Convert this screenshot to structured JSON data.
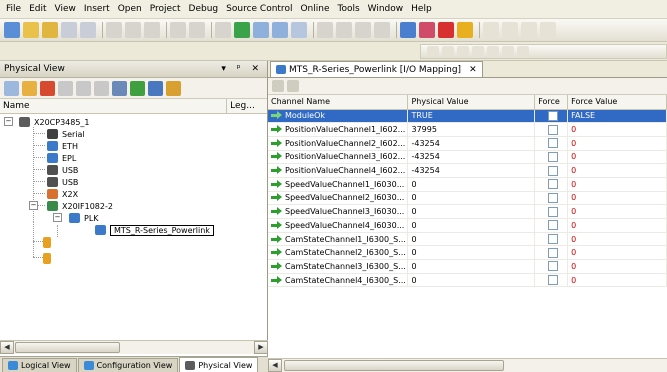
{
  "menu": [
    "File",
    "Edit",
    "View",
    "Insert",
    "Open",
    "Project",
    "Debug",
    "Source Control",
    "Online",
    "Tools",
    "Window",
    "Help"
  ],
  "left_pane": {
    "title": "Physical View",
    "controls": "▾ ᵖ ✕",
    "col_name": "Name",
    "col_leg": "Leg...",
    "tree": {
      "root": "X20CP3485_1",
      "serial": "Serial",
      "eth": "ETH",
      "epl": "EPL",
      "usb1": "USB",
      "usb2": "USB",
      "x2x": "X2X",
      "if": "X20IF1082-2",
      "plk": "PLK",
      "device": "MTS_R-Series_Powerlink"
    },
    "tabs": [
      "Logical View",
      "Configuration View",
      "Physical View"
    ]
  },
  "document": {
    "tab_label": "MTS_R-Series_Powerlink [I/O Mapping]",
    "tab_close": "✕",
    "columns": [
      "Channel Name",
      "Physical Value",
      "Force",
      "Force Value"
    ],
    "rows": [
      {
        "name": "ModuleOk",
        "value": "TRUE",
        "force_value": "FALSE"
      },
      {
        "name": "PositionValueChannel1_I602...",
        "value": "37995",
        "force_value": "0"
      },
      {
        "name": "PositionValueChannel2_I602...",
        "value": "-43254",
        "force_value": "0"
      },
      {
        "name": "PositionValueChannel3_I602...",
        "value": "-43254",
        "force_value": "0"
      },
      {
        "name": "PositionValueChannel4_I602...",
        "value": "-43254",
        "force_value": "0"
      },
      {
        "name": "SpeedValueChannel1_I6030...",
        "value": "0",
        "force_value": "0"
      },
      {
        "name": "SpeedValueChannel2_I6030...",
        "value": "0",
        "force_value": "0"
      },
      {
        "name": "SpeedValueChannel3_I6030...",
        "value": "0",
        "force_value": "0"
      },
      {
        "name": "SpeedValueChannel4_I6030...",
        "value": "0",
        "force_value": "0"
      },
      {
        "name": "CamStateChannel1_I6300_S...",
        "value": "0",
        "force_value": "0"
      },
      {
        "name": "CamStateChannel2_I6300_S...",
        "value": "0",
        "force_value": "0"
      },
      {
        "name": "CamStateChannel3_I6300_S...",
        "value": "0",
        "force_value": "0"
      },
      {
        "name": "CamStateChannel4_I6300_S...",
        "value": "0",
        "force_value": "0"
      }
    ]
  },
  "colors": {
    "selection": "#316AC5",
    "force_value": "#D00000",
    "arrow": "#2E9E2E"
  }
}
